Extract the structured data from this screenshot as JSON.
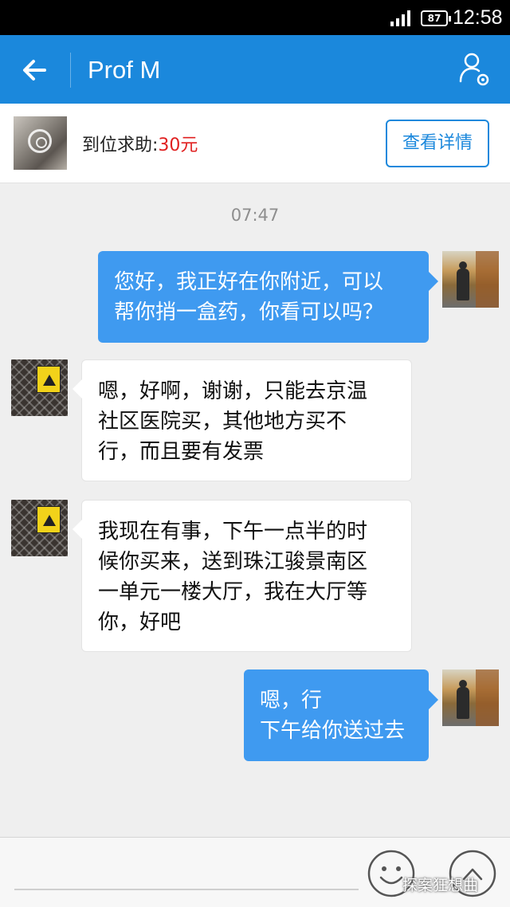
{
  "status_bar": {
    "battery": "87",
    "time": "12:58"
  },
  "header": {
    "title": "Prof M",
    "back_icon": "back-arrow-icon",
    "settings_icon": "profile-settings-icon",
    "color": "#1b88dc"
  },
  "order": {
    "label": "到位求助:",
    "price": "30元",
    "detail_button": "查看详情",
    "price_color": "#e02020"
  },
  "chat": {
    "timestamp": "07:47",
    "messages": [
      {
        "from": "self",
        "lines": [
          "您好，我正好在你附近，可以",
          "帮你捎一盒药，你看可以吗？"
        ]
      },
      {
        "from": "other",
        "lines": [
          "嗯，好啊，谢谢，只能去京温",
          "社区医院买，其他地方买不",
          "行，而且要有发票"
        ]
      },
      {
        "from": "other",
        "lines": [
          "我现在有事，下午一点半的时",
          "候你买来，送到珠江骏景南区",
          "一单元一楼大厅，我在大厅等",
          "你，好吧"
        ]
      },
      {
        "from": "self",
        "lines": [
          "嗯，行",
          "下午给你送过去"
        ]
      }
    ]
  },
  "input": {
    "placeholder": "",
    "emoji_icon": "smiley-face-icon",
    "more_icon": "more-options-icon"
  },
  "watermark": "探案狂想曲"
}
